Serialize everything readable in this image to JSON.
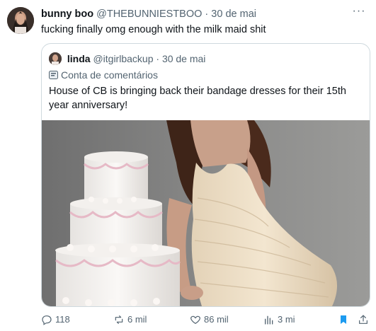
{
  "tweet": {
    "author_name": "bunny boo",
    "author_handle": "@THEBUNNIESTBOO",
    "separator": "·",
    "date": "30 de mai",
    "text": "fucking finally omg enough with the milk maid shit",
    "more_icon": "more-horizontal-icon"
  },
  "quoted": {
    "author_name": "linda",
    "author_handle": "@itgirlbackup",
    "separator": "·",
    "date": "30 de mai",
    "account_label": "Conta de comentários",
    "text": "House of CB is bringing back their bandage dresses for their 15th year anniversary!"
  },
  "actions": {
    "replies": "118",
    "reposts": "6 mil",
    "likes": "86 mil",
    "views": "3 mi"
  },
  "colors": {
    "text": "#0f1419",
    "muted": "#536471",
    "border": "#cfd9de",
    "bookmark": "#1d9bf0"
  }
}
